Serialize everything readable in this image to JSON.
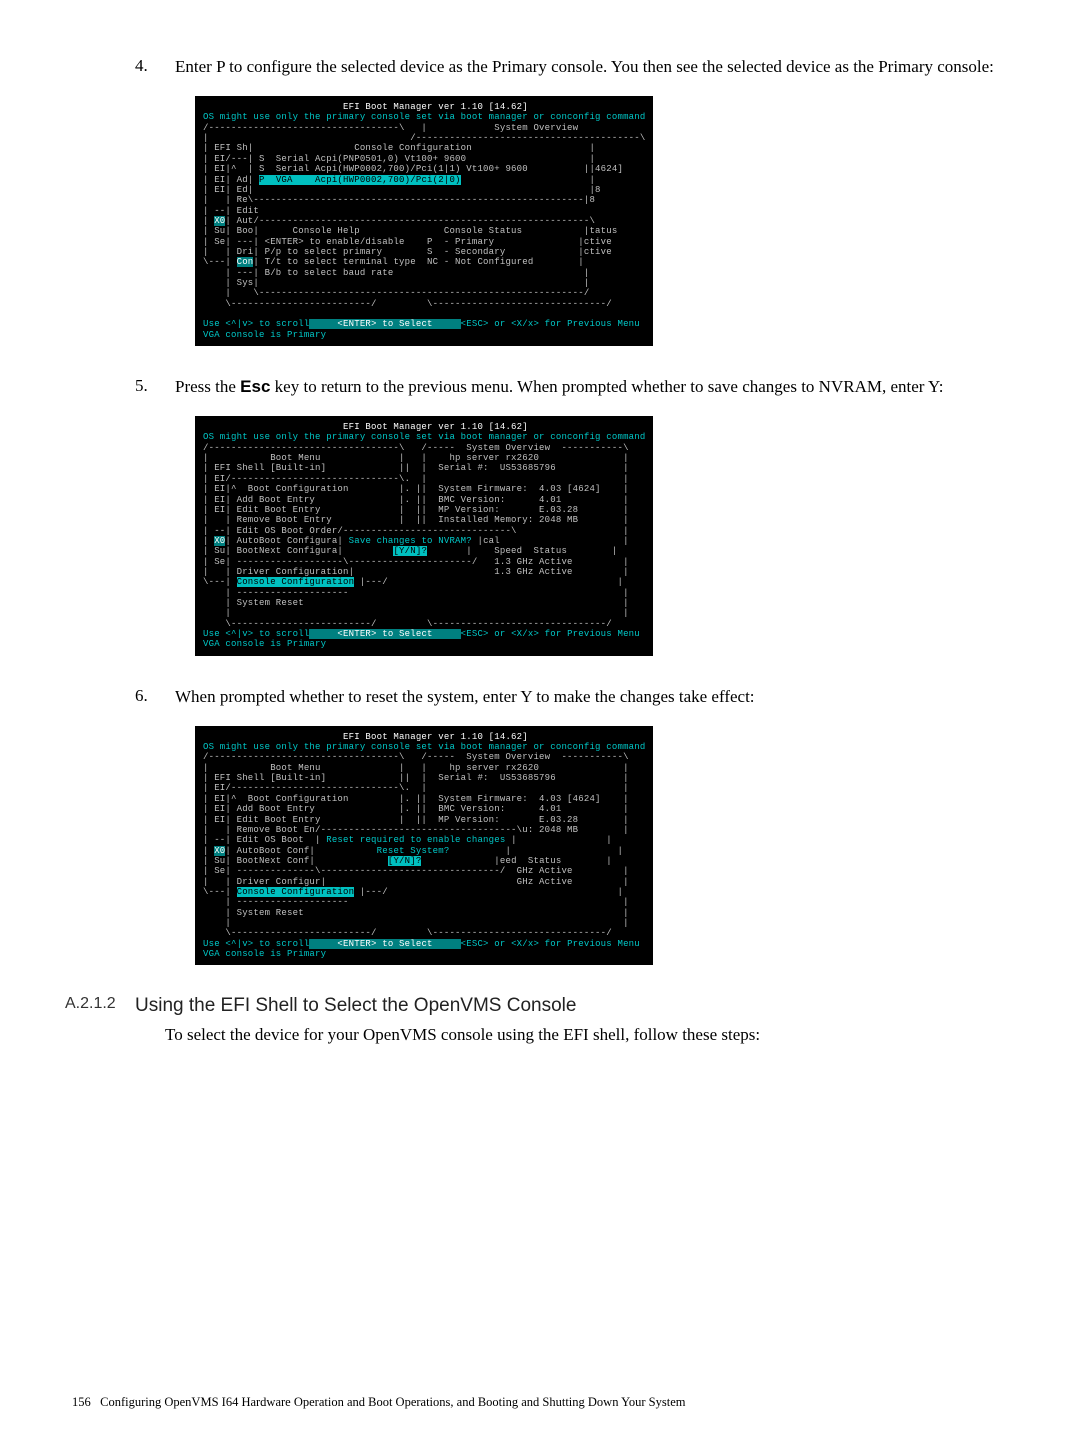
{
  "steps": {
    "s4": {
      "num": "4.",
      "text": "Enter P to configure the selected device as the Primary console. You then see the selected device as the Primary console:"
    },
    "s5": {
      "num": "5.",
      "text_before": "Press the ",
      "key": "Esc",
      "text_after": " key to return to the previous menu. When prompted whether to save changes to NVRAM, enter Y:"
    },
    "s6": {
      "num": "6.",
      "text": "When prompted whether to reset the system, enter Y to make the changes take effect:"
    }
  },
  "heading": {
    "num": "A.2.1.2",
    "title": "Using the EFI Shell to Select the OpenVMS Console",
    "body": "To select the device for your OpenVMS console using the EFI shell, follow these steps:"
  },
  "footer": {
    "page": "156",
    "title": "Configuring OpenVMS I64 Hardware Operation and Boot Operations, and Booting and Shutting Down Your System"
  },
  "term1": {
    "title": "                         EFI Boot Manager ver 1.10 [14.62]",
    "warn": "OS might use only the primary console set via boot manager or conconfig command",
    "l01": "/----------------------------------\\   |            System Overview           ",
    "l02": "|                                    /----------------------------------------\\",
    "l03": "| EFI Sh|                  Console Configuration                     |",
    "l04": "| EI/---| S  Serial Acpi(PNP0501,0) Vt100+ 9600                      |",
    "l05": "| EI|^  | S  Serial Acpi(HWP0002,700)/Pci(1|1) Vt100+ 9600          ||4624]",
    "l06": "| EI| Ad| ",
    "l06b": "P  VGA    Acpi(HWP0002,700)/Pci(2|0)",
    "l06c": "                       |",
    "l07": "| EI| Ed|                                                            |8",
    "l08": "|   | Re\\-----------------------------------------------------------|8",
    "l09": "| --| Edit",
    "l10": "| ",
    "l10a": "X0",
    "l10b": "| Aut/-----------------------------------------------------------\\",
    "l11": "| Su| Boo|      Console Help               Console Status           |tatus",
    "l12": "| Se| ---| <ENTER> to enable/disable    P  - Primary               |ctive",
    "l13": "|   | Dri| P/p to select primary        S  - Secondary             |ctive",
    "l14": "\\---| ",
    "l14a": "Con",
    "l14b": "| T/t to select terminal type  NC - Not Configured        |",
    "l15": "    | ---| B/b to select baud rate                                  |",
    "l16": "    | Sys|                                                          |",
    "l17": "    |    \\----------------------------------------------------------/",
    "l18": "    \\-------------------------/         \\-------------------------------/",
    "l19": "",
    "f1a": "Use <^|v> to scroll",
    "f1b": "     <ENTER> to Select     ",
    "f1c": "<ESC> or <X/x> for Previous Menu",
    "f2": "VGA console is Primary"
  },
  "term2": {
    "title": "                         EFI Boot Manager ver 1.10 [14.62]",
    "warn": "OS might use only the primary console set via boot manager or conconfig command",
    "l01": "/----------------------------------\\   /-----  System Overview  -----------\\",
    "l02": "|           Boot Menu              |   |    hp server rx2620               |",
    "l03": "| EFI Shell [Built-in]             ||  |  Serial #:  US53685796            |",
    "l04": "| EI/------------------------------\\.  |                                   |",
    "l05": "| EI|^  Boot Configuration         |. ||  System Firmware:  4.03 [4624]    |",
    "l06": "| EI| Add Boot Entry               |. ||  BMC Version:      4.01           |",
    "l07": "| EI| Edit Boot Entry              |  ||  MP Version:       E.03.28        |",
    "l08": "|   | Remove Boot Entry            |  ||  Installed Memory: 2048 MB        |",
    "l09": "| --| Edit OS Boot Order/------------------------------\\                   |",
    "l10": "| ",
    "l10a": "X0",
    "l10b": "| AutoBoot Configura| ",
    "l10c": "Save changes to NVRAM?",
    "l10d": " |cal                      |",
    "l11": "| Su| BootNext Configura|         ",
    "l11a": "[Y/N]?",
    "l11b": "       |    Speed  Status        |",
    "l12": "| Se| -------------------\\----------------------/   1.3 GHz Active         |",
    "l13": "|   | Driver Configuration|                         1.3 GHz Active         |",
    "l14": "\\---| ",
    "l14a": "Console Configuration",
    "l14b": " |---/                                         |",
    "l15": "    | --------------------                                                 |",
    "l16": "    | System Reset                                                         |",
    "l17": "    |                                                                      |",
    "l18": "    \\-------------------------/         \\-------------------------------/",
    "f1a": "Use <^|v> to scroll",
    "f1b": "     <ENTER> to Select     ",
    "f1c": "<ESC> or <X/x> for Previous Menu",
    "f2": "VGA console is Primary"
  },
  "term3": {
    "title": "                         EFI Boot Manager ver 1.10 [14.62]",
    "warn": "OS might use only the primary console set via boot manager or conconfig command",
    "l01": "/----------------------------------\\   /-----  System Overview  -----------\\",
    "l02": "|           Boot Menu              |   |    hp server rx2620               |",
    "l03": "| EFI Shell [Built-in]             ||  |  Serial #:  US53685796            |",
    "l04": "| EI/------------------------------\\.  |                                   |",
    "l05": "| EI|^  Boot Configuration         |. ||  System Firmware:  4.03 [4624]    |",
    "l06": "| EI| Add Boot Entry               |. ||  BMC Version:      4.01           |",
    "l07": "| EI| Edit Boot Entry              |  ||  MP Version:       E.03.28        |",
    "l08": "|   | Remove Boot En/-----------------------------------\\u: 2048 MB        |",
    "l09": "| --| Edit OS Boot  | ",
    "l09a": "Reset required to enable changes",
    "l09b": " |                |",
    "l10": "| ",
    "l10a": "X0",
    "l10b": "| AutoBoot Conf|           ",
    "l10c": "Reset System?",
    "l10d": "          |                   |",
    "l11": "| Su| BootNext Conf|             ",
    "l11a": "[Y/N]?",
    "l11b": "             |eed  Status        |",
    "l12": "| Se| --------------\\--------------------------------/  GHz Active         |",
    "l13": "|   | Driver Configur|                                  GHz Active         |",
    "l14": "\\---| ",
    "l14a": "Console Configuration",
    "l14b": " |---/                                         |",
    "l15": "    | --------------------                                                 |",
    "l16": "    | System Reset                                                         |",
    "l17": "    |                                                                      |",
    "l18": "    \\-------------------------/         \\-------------------------------/",
    "f1a": "Use <^|v> to scroll",
    "f1b": "     <ENTER> to Select     ",
    "f1c": "<ESC> or <X/x> for Previous Menu",
    "f2": "VGA console is Primary"
  }
}
